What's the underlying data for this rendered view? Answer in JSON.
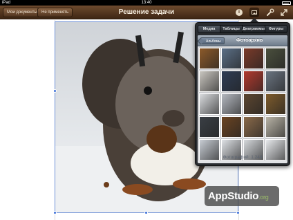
{
  "status_bar": {
    "carrier": "iPad",
    "time": "13:40"
  },
  "toolbar": {
    "documents_label": "Мои документы",
    "undo_label": "Не применять",
    "title": "Решение задачи",
    "icons": [
      "info-icon",
      "media-icon",
      "tools-icon",
      "fullscreen-icon"
    ]
  },
  "popover": {
    "tabs": [
      {
        "label": "Медиа",
        "active": true
      },
      {
        "label": "Таблицы",
        "active": false
      },
      {
        "label": "Диаграммы",
        "active": false
      },
      {
        "label": "Фигуры",
        "active": false
      }
    ],
    "back_label": "Альбомы",
    "title": "Фотоархив",
    "photo_count": "Фотографий: 1 249",
    "thumbnail_colors": [
      "#8c5a2a",
      "#5b6f86",
      "#7a3b2a",
      "#4a4f3d",
      "#c9c6c0",
      "#2f3d55",
      "#b23a2e",
      "#6a7480",
      "#d9dbde",
      "#b4b8bf",
      "#5c4630",
      "#7d5b2c",
      "#3a3f45",
      "#6b4422",
      "#8a6a4a",
      "#b8b3a6",
      "#c8cdd4",
      "#dfe2e6",
      "#d6d9dc",
      "#e7e9ec"
    ]
  },
  "watermark": {
    "brand": "AppStudio",
    "tld": ".org"
  }
}
